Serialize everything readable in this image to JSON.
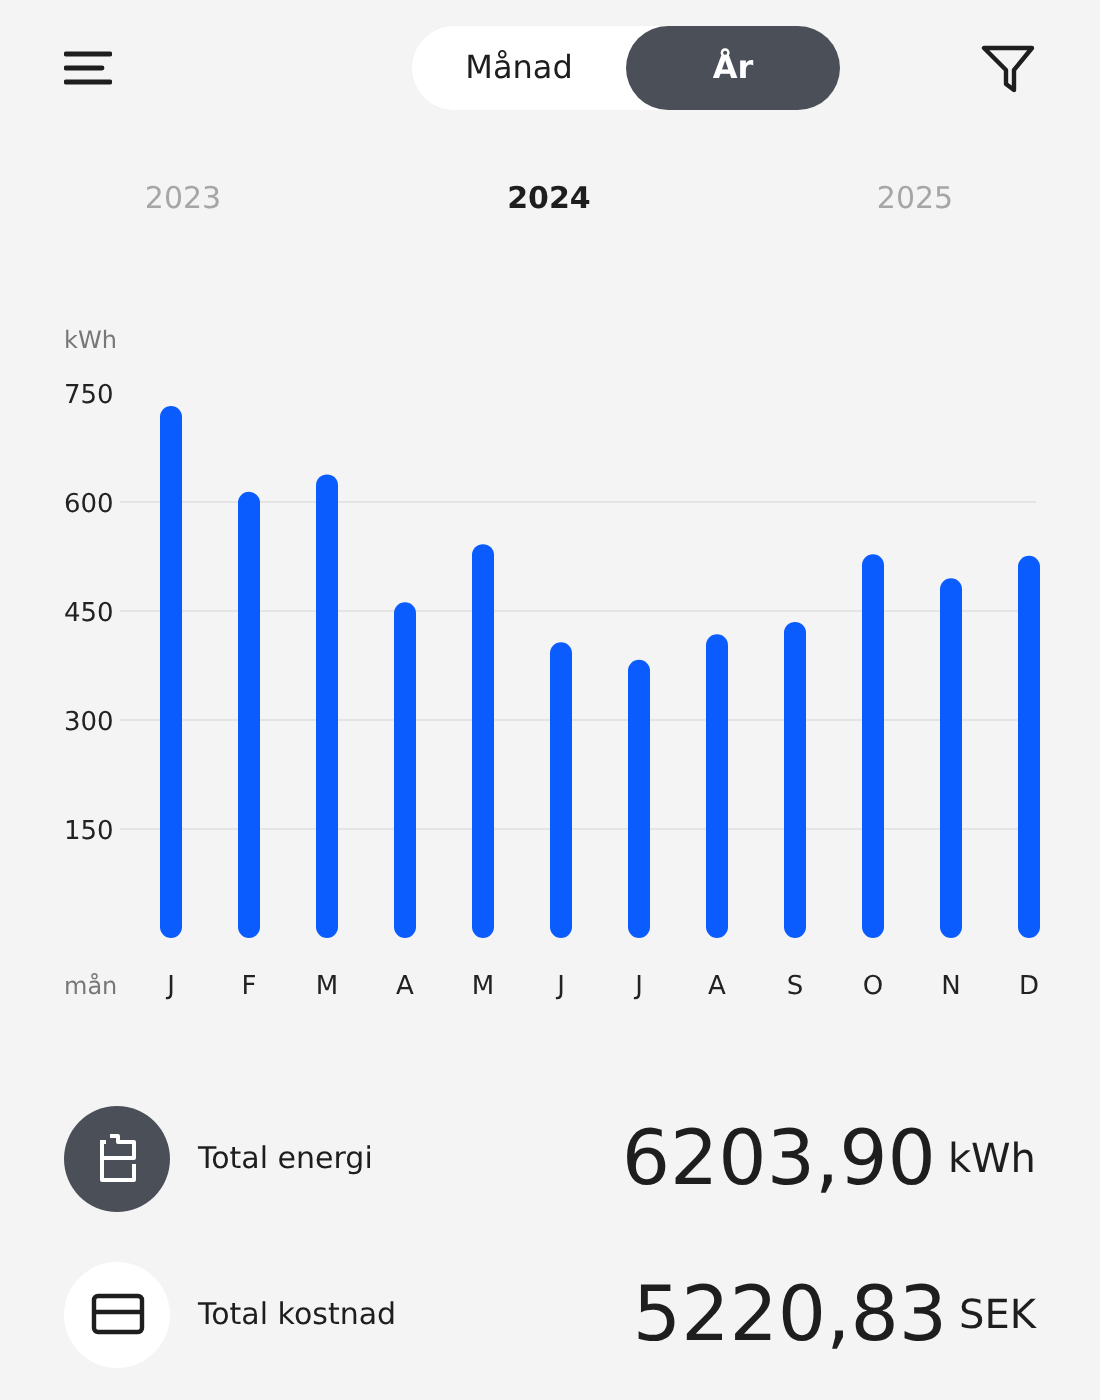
{
  "header": {
    "segments": [
      {
        "label": "Månad",
        "selected": false
      },
      {
        "label": "År",
        "selected": true
      }
    ]
  },
  "years": [
    {
      "label": "2023",
      "selected": false
    },
    {
      "label": "2024",
      "selected": true
    },
    {
      "label": "2025",
      "selected": false
    }
  ],
  "chart": {
    "chart_data": {
      "type": "bar",
      "xlabel": "mån",
      "ylabel": "kWh",
      "categories": [
        "J",
        "F",
        "M",
        "A",
        "M",
        "J",
        "J",
        "A",
        "S",
        "O",
        "N",
        "D"
      ],
      "grid": true,
      "series": [
        {
          "color": "#0a5cff",
          "values": [
            732,
            614,
            638,
            462,
            542,
            407,
            383,
            418,
            435,
            528,
            495,
            526
          ]
        }
      ],
      "ylim": [
        0,
        750
      ],
      "yticks": [
        150,
        300,
        450,
        600,
        750
      ]
    }
  },
  "totals": [
    {
      "kind": "energy",
      "label": "Total energi",
      "value": "6203,90",
      "unit": "kWh"
    },
    {
      "kind": "cost",
      "label": "Total kostnad",
      "value": "5220,83",
      "unit": "SEK"
    }
  ]
}
